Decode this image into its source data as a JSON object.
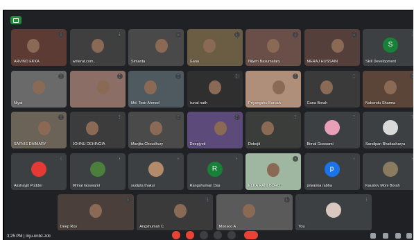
{
  "meeting": {
    "time_text": "3:25 PM | mju-nnbz-zdc",
    "tiles": [
      {
        "id": "t1",
        "name": "ARVIND EKKA",
        "bg": "#5b3b33",
        "type": "photo"
      },
      {
        "id": "t2",
        "name": "writerat.com...",
        "bg": "#3f3f3f",
        "type": "photo"
      },
      {
        "id": "t3",
        "name": "Simanta",
        "bg": "#494949",
        "type": "photo"
      },
      {
        "id": "t4",
        "name": "Gana",
        "bg": "#6b5d44",
        "type": "photo"
      },
      {
        "id": "t5",
        "name": "Nijwm Basumatary",
        "bg": "#6a4f49",
        "type": "photo"
      },
      {
        "id": "t6",
        "name": "MERAJ HUSSAIN",
        "bg": "#553f3b",
        "type": "photo"
      },
      {
        "id": "t7",
        "name": "Skill Development",
        "bg": "#3c4043",
        "type": "avatar",
        "initial": "S",
        "avatar_color": "#188038"
      },
      {
        "id": "t8",
        "name": "Niyat",
        "bg": "#6a6a6a",
        "type": "photo"
      },
      {
        "id": "t9",
        "name": "",
        "bg": "#8b6e65",
        "type": "photo"
      },
      {
        "id": "t10",
        "name": "Md. Tosir Ahmed",
        "bg": "#4e5a5f",
        "type": "photo"
      },
      {
        "id": "t11",
        "name": "kunal nath",
        "bg": "#2f2f2f",
        "type": "photo"
      },
      {
        "id": "t12",
        "name": "Priyangshu Baruah",
        "bg": "#b08f7a",
        "type": "photo"
      },
      {
        "id": "t13",
        "name": "Guna Borah",
        "bg": "#3a3a3a",
        "type": "photo"
      },
      {
        "id": "t14",
        "name": "Nabendu Sharma",
        "bg": "#5a4538",
        "type": "photo"
      },
      {
        "id": "t15",
        "name": "SARVIS DAIMARY",
        "bg": "#6b6258",
        "type": "photo"
      },
      {
        "id": "t16",
        "name": "JOHNU DEHINGIA",
        "bg": "#3c3c3c",
        "type": "photo"
      },
      {
        "id": "t17",
        "name": "Manjita Choudhury",
        "bg": "#4a4a4a",
        "type": "photo"
      },
      {
        "id": "t18",
        "name": "Deepjyoti",
        "bg": "#5c4a7a",
        "type": "photo"
      },
      {
        "id": "t19",
        "name": "Debojit",
        "bg": "#3a3d3a",
        "type": "photo"
      },
      {
        "id": "t20",
        "name": "Bimal Goswami",
        "bg": "#3c4043",
        "type": "avatar",
        "initial": "",
        "avatar_color": "#e8a0b8"
      },
      {
        "id": "t21",
        "name": "Sandipan Bhattacharya",
        "bg": "#3c4043",
        "type": "avatar",
        "initial": "",
        "avatar_color": "#d9d9d9"
      },
      {
        "id": "t22",
        "name": "Akshayjit Podder",
        "bg": "#3c4043",
        "type": "avatar",
        "initial": "",
        "avatar_color": "#e53935"
      },
      {
        "id": "t23",
        "name": "Mrinal Goswami",
        "bg": "#3c4043",
        "type": "avatar",
        "initial": "",
        "avatar_color": "#4a7f3c"
      },
      {
        "id": "t24",
        "name": "sudipta thakur",
        "bg": "#3c4043",
        "type": "avatar",
        "initial": "",
        "avatar_color": "#b38a6a"
      },
      {
        "id": "t25",
        "name": "Rangshuman Das",
        "bg": "#3c4043",
        "type": "avatar",
        "initial": "R",
        "avatar_color": "#188038"
      },
      {
        "id": "t26",
        "name": "ELKA RANI BORO",
        "bg": "#9fb7a0",
        "type": "photo"
      },
      {
        "id": "t27",
        "name": "priyanka rabha",
        "bg": "#3c4043",
        "type": "avatar",
        "initial": "p",
        "avatar_color": "#1a73e8"
      },
      {
        "id": "t28",
        "name": "Kaustov Moni Borah",
        "bg": "#3c4043",
        "type": "avatar",
        "initial": "",
        "avatar_color": "#8a7a60"
      },
      {
        "id": "t29",
        "name": "Deep Roy",
        "bg": "#4a3f3a",
        "type": "photo"
      },
      {
        "id": "t30",
        "name": "Angshuman C",
        "bg": "#3a3a3a",
        "type": "photo"
      },
      {
        "id": "t31",
        "name": "Monsoo A",
        "bg": "#5a5a5a",
        "type": "photo"
      },
      {
        "id": "t32",
        "name": "You",
        "bg": "#3c4043",
        "type": "avatar",
        "initial": "",
        "avatar_color": "#d8c8c0"
      }
    ]
  },
  "colors": {
    "background": "#202124",
    "tile": "#3c4043",
    "red": "#ea4335",
    "green": "#1e8e3e"
  }
}
